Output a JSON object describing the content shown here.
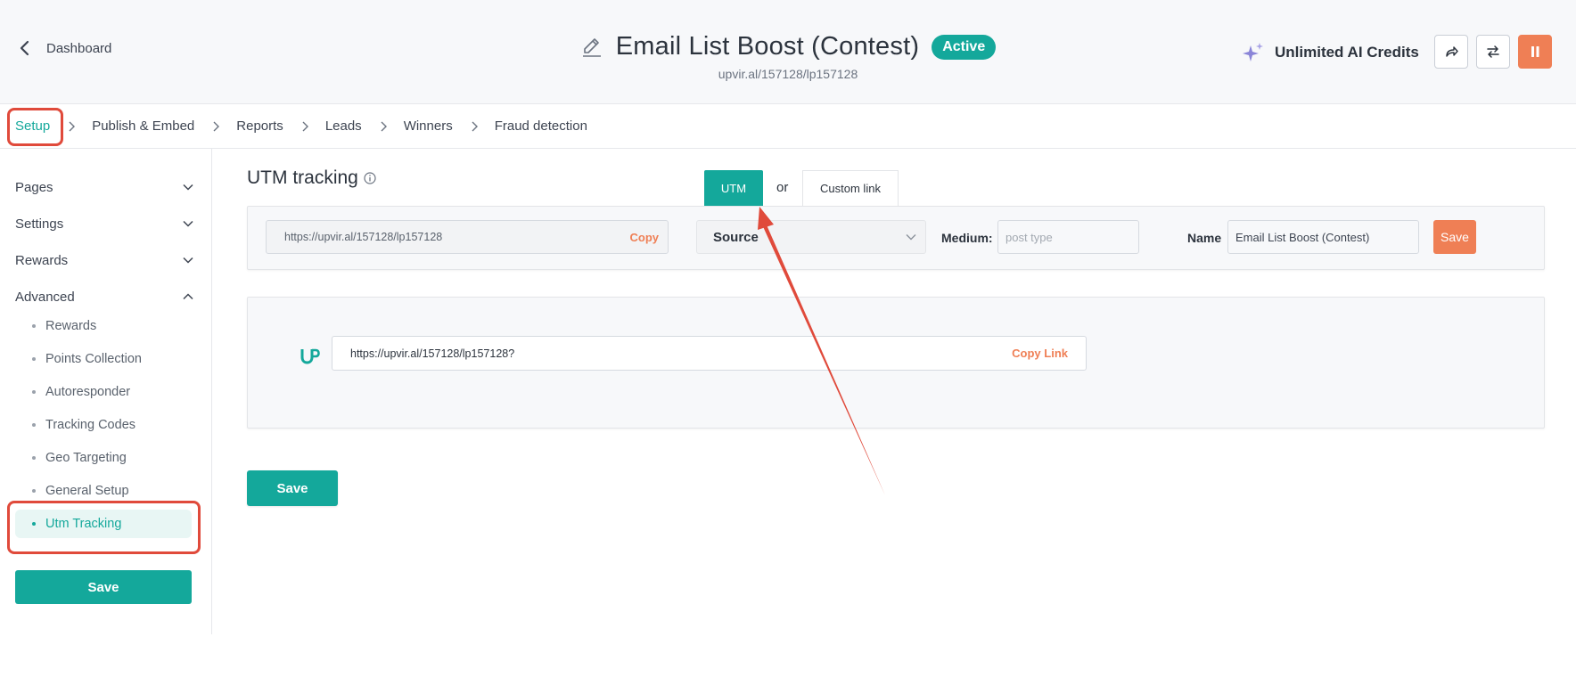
{
  "header": {
    "back_label": "Dashboard",
    "title": "Email List Boost (Contest)",
    "status": "Active",
    "subtitle": "upvir.al/157128/lp157128",
    "ai_credits": "Unlimited AI Credits",
    "icons": [
      "chevron-left-icon",
      "pencil-icon",
      "sparkles-icon",
      "share-icon",
      "swap-icon",
      "pause-icon"
    ]
  },
  "breadcrumb": [
    {
      "label": "Setup",
      "active": true
    },
    {
      "label": "Publish & Embed"
    },
    {
      "label": "Reports"
    },
    {
      "label": "Leads"
    },
    {
      "label": "Winners"
    },
    {
      "label": "Fraud detection"
    }
  ],
  "sidebar": {
    "sections": [
      {
        "label": "Pages",
        "expanded": false
      },
      {
        "label": "Settings",
        "expanded": false
      },
      {
        "label": "Rewards",
        "expanded": false
      },
      {
        "label": "Advanced",
        "expanded": true
      }
    ],
    "advanced_items": [
      {
        "label": "Rewards"
      },
      {
        "label": "Points Collection"
      },
      {
        "label": "Autoresponder"
      },
      {
        "label": "Tracking Codes"
      },
      {
        "label": "Geo Targeting"
      },
      {
        "label": "General Setup"
      },
      {
        "label": "Utm Tracking",
        "active": true
      }
    ],
    "save_label": "Save"
  },
  "main": {
    "title": "UTM tracking",
    "tabs": {
      "utm": "UTM",
      "or": "or",
      "custom": "Custom link"
    },
    "utm": {
      "url": "https://upvir.al/157128/lp157128",
      "copy_label": "Copy",
      "source_label": "Source",
      "medium_label": "Medium:",
      "medium_placeholder": "post type",
      "name_label": "Name",
      "name_value": "Email List Boost (Contest)",
      "save_label": "Save"
    },
    "generated": {
      "url": "https://upvir.al/157128/lp157128?",
      "copy_label": "Copy Link"
    },
    "save_label": "Save"
  },
  "colors": {
    "accent": "#14a89b",
    "orange": "#ef7f55",
    "annotation": "#e04a3b"
  }
}
